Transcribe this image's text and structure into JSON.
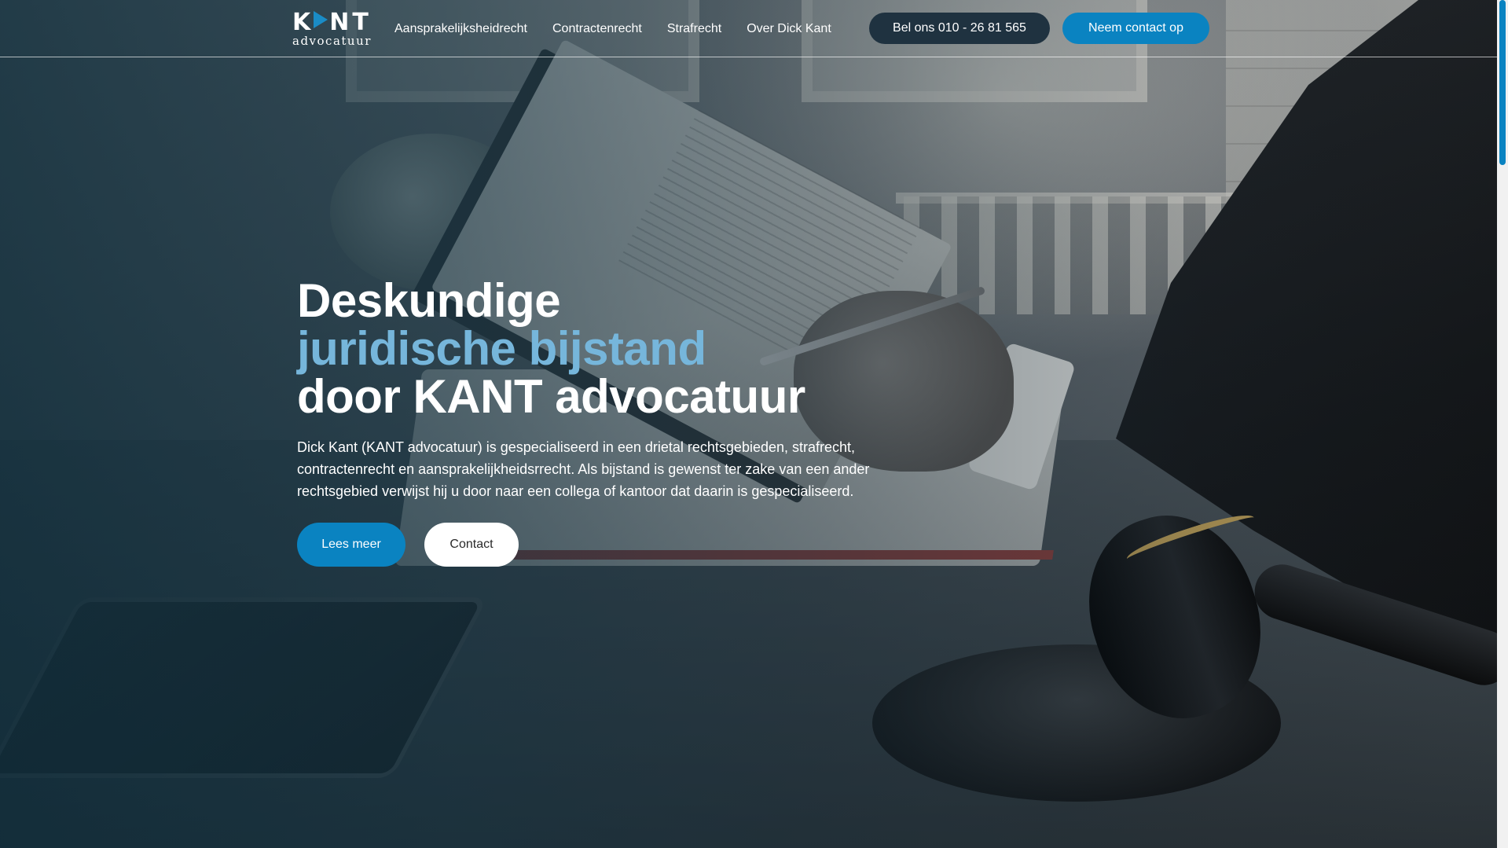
{
  "brand": {
    "name_part1": "K",
    "name_part2": "NT",
    "subtitle": "advocatuur",
    "accent_color": "#0a83c1",
    "highlight_color": "#76b6db"
  },
  "nav": {
    "items": [
      {
        "label": "Aansprakelijksheidrecht"
      },
      {
        "label": "Contractenrecht"
      },
      {
        "label": "Strafrecht"
      },
      {
        "label": "Over Dick Kant"
      }
    ],
    "call_button": "Bel ons 010 - 26 81 565",
    "contact_button": "Neem contact op"
  },
  "hero": {
    "title_line1": "Deskundige",
    "title_line2": "juridische bijstand",
    "title_line3": "door KANT advocatuur",
    "description": "Dick Kant (KANT advocatuur) is gespecialiseerd in een drietal rechtsgebieden, strafrecht, contractenrecht en aansprakelijkheidsrrecht. Als bijstand is gewenst ter zake van een ander rechtsgebied verwijst hij u door naar een collega of kantoor dat daarin is gespecialiseerd.",
    "primary_button": "Lees meer",
    "secondary_button": "Contact"
  },
  "scrollbar": {
    "thumb_color": "#0a83c1"
  }
}
